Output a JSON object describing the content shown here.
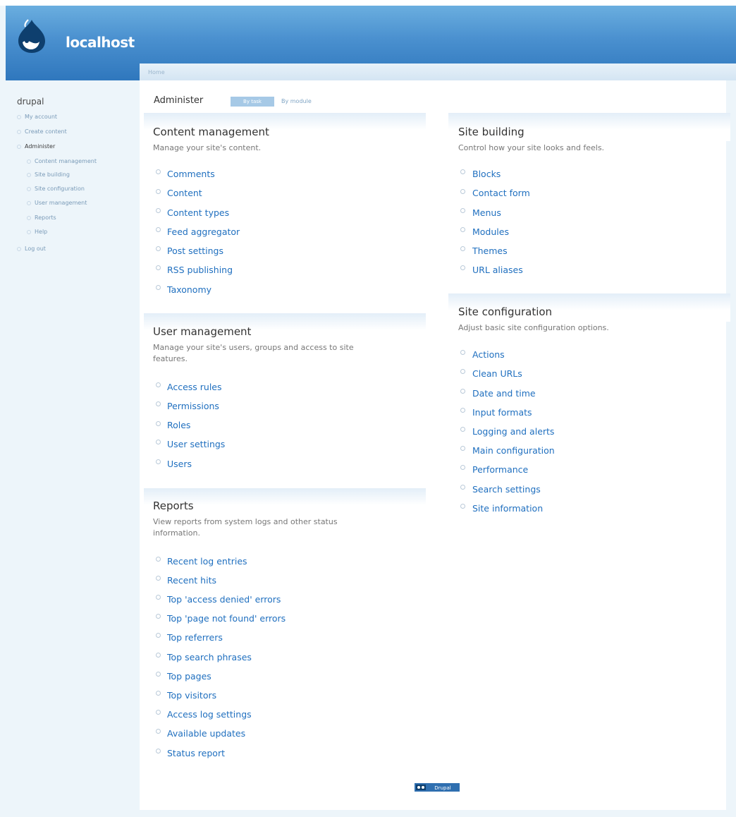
{
  "site": {
    "name": "localhost"
  },
  "breadcrumb": "Home",
  "sidebar": {
    "title": "drupal",
    "items": [
      {
        "label": "My account",
        "active": false,
        "level": 0
      },
      {
        "label": "Create content",
        "active": false,
        "level": 0
      },
      {
        "label": "Administer",
        "active": true,
        "level": 0
      },
      {
        "label": "Content management",
        "active": false,
        "level": 1
      },
      {
        "label": "Site building",
        "active": false,
        "level": 1
      },
      {
        "label": "Site configuration",
        "active": false,
        "level": 1
      },
      {
        "label": "User management",
        "active": false,
        "level": 1
      },
      {
        "label": "Reports",
        "active": false,
        "level": 1
      },
      {
        "label": "Help",
        "active": false,
        "level": 1
      },
      {
        "label": "Log out",
        "active": false,
        "level": 0
      }
    ]
  },
  "page": {
    "title": "Administer",
    "tabs": {
      "active": "By task",
      "other": "By module"
    }
  },
  "panels": {
    "content_management": {
      "title": "Content management",
      "desc": "Manage your site's content.",
      "links": [
        "Comments",
        "Content",
        "Content types",
        "Feed aggregator",
        "Post settings",
        "RSS publishing",
        "Taxonomy"
      ]
    },
    "user_management": {
      "title": "User management",
      "desc_line1": "Manage your site's users, groups and access to site",
      "desc_line2": "features.",
      "links": [
        "Access rules",
        "Permissions",
        "Roles",
        "User settings",
        "Users"
      ]
    },
    "reports": {
      "title": "Reports",
      "desc_line1": "View reports from system logs and other status",
      "desc_line2": "information.",
      "links": [
        "Recent log entries",
        "Recent hits",
        "Top 'access denied' errors",
        "Top 'page not found' errors",
        "Top referrers",
        "Top search phrases",
        "Top pages",
        "Top visitors",
        "Access log settings",
        "Available updates",
        "Status report"
      ]
    },
    "site_building": {
      "title": "Site building",
      "desc": "Control how your site looks and feels.",
      "links": [
        "Blocks",
        "Contact form",
        "Menus",
        "Modules",
        "Themes",
        "URL aliases"
      ]
    },
    "site_configuration": {
      "title": "Site configuration",
      "desc": "Adjust basic site configuration options.",
      "links": [
        "Actions",
        "Clean URLs",
        "Date and time",
        "Input formats",
        "Logging and alerts",
        "Main configuration",
        "Performance",
        "Search settings",
        "Site information"
      ]
    }
  },
  "footer": {
    "badge": "Drupal"
  },
  "colors": {
    "header": "#4a90cf",
    "link": "#1f6fbf",
    "background": "#edf5fa"
  }
}
